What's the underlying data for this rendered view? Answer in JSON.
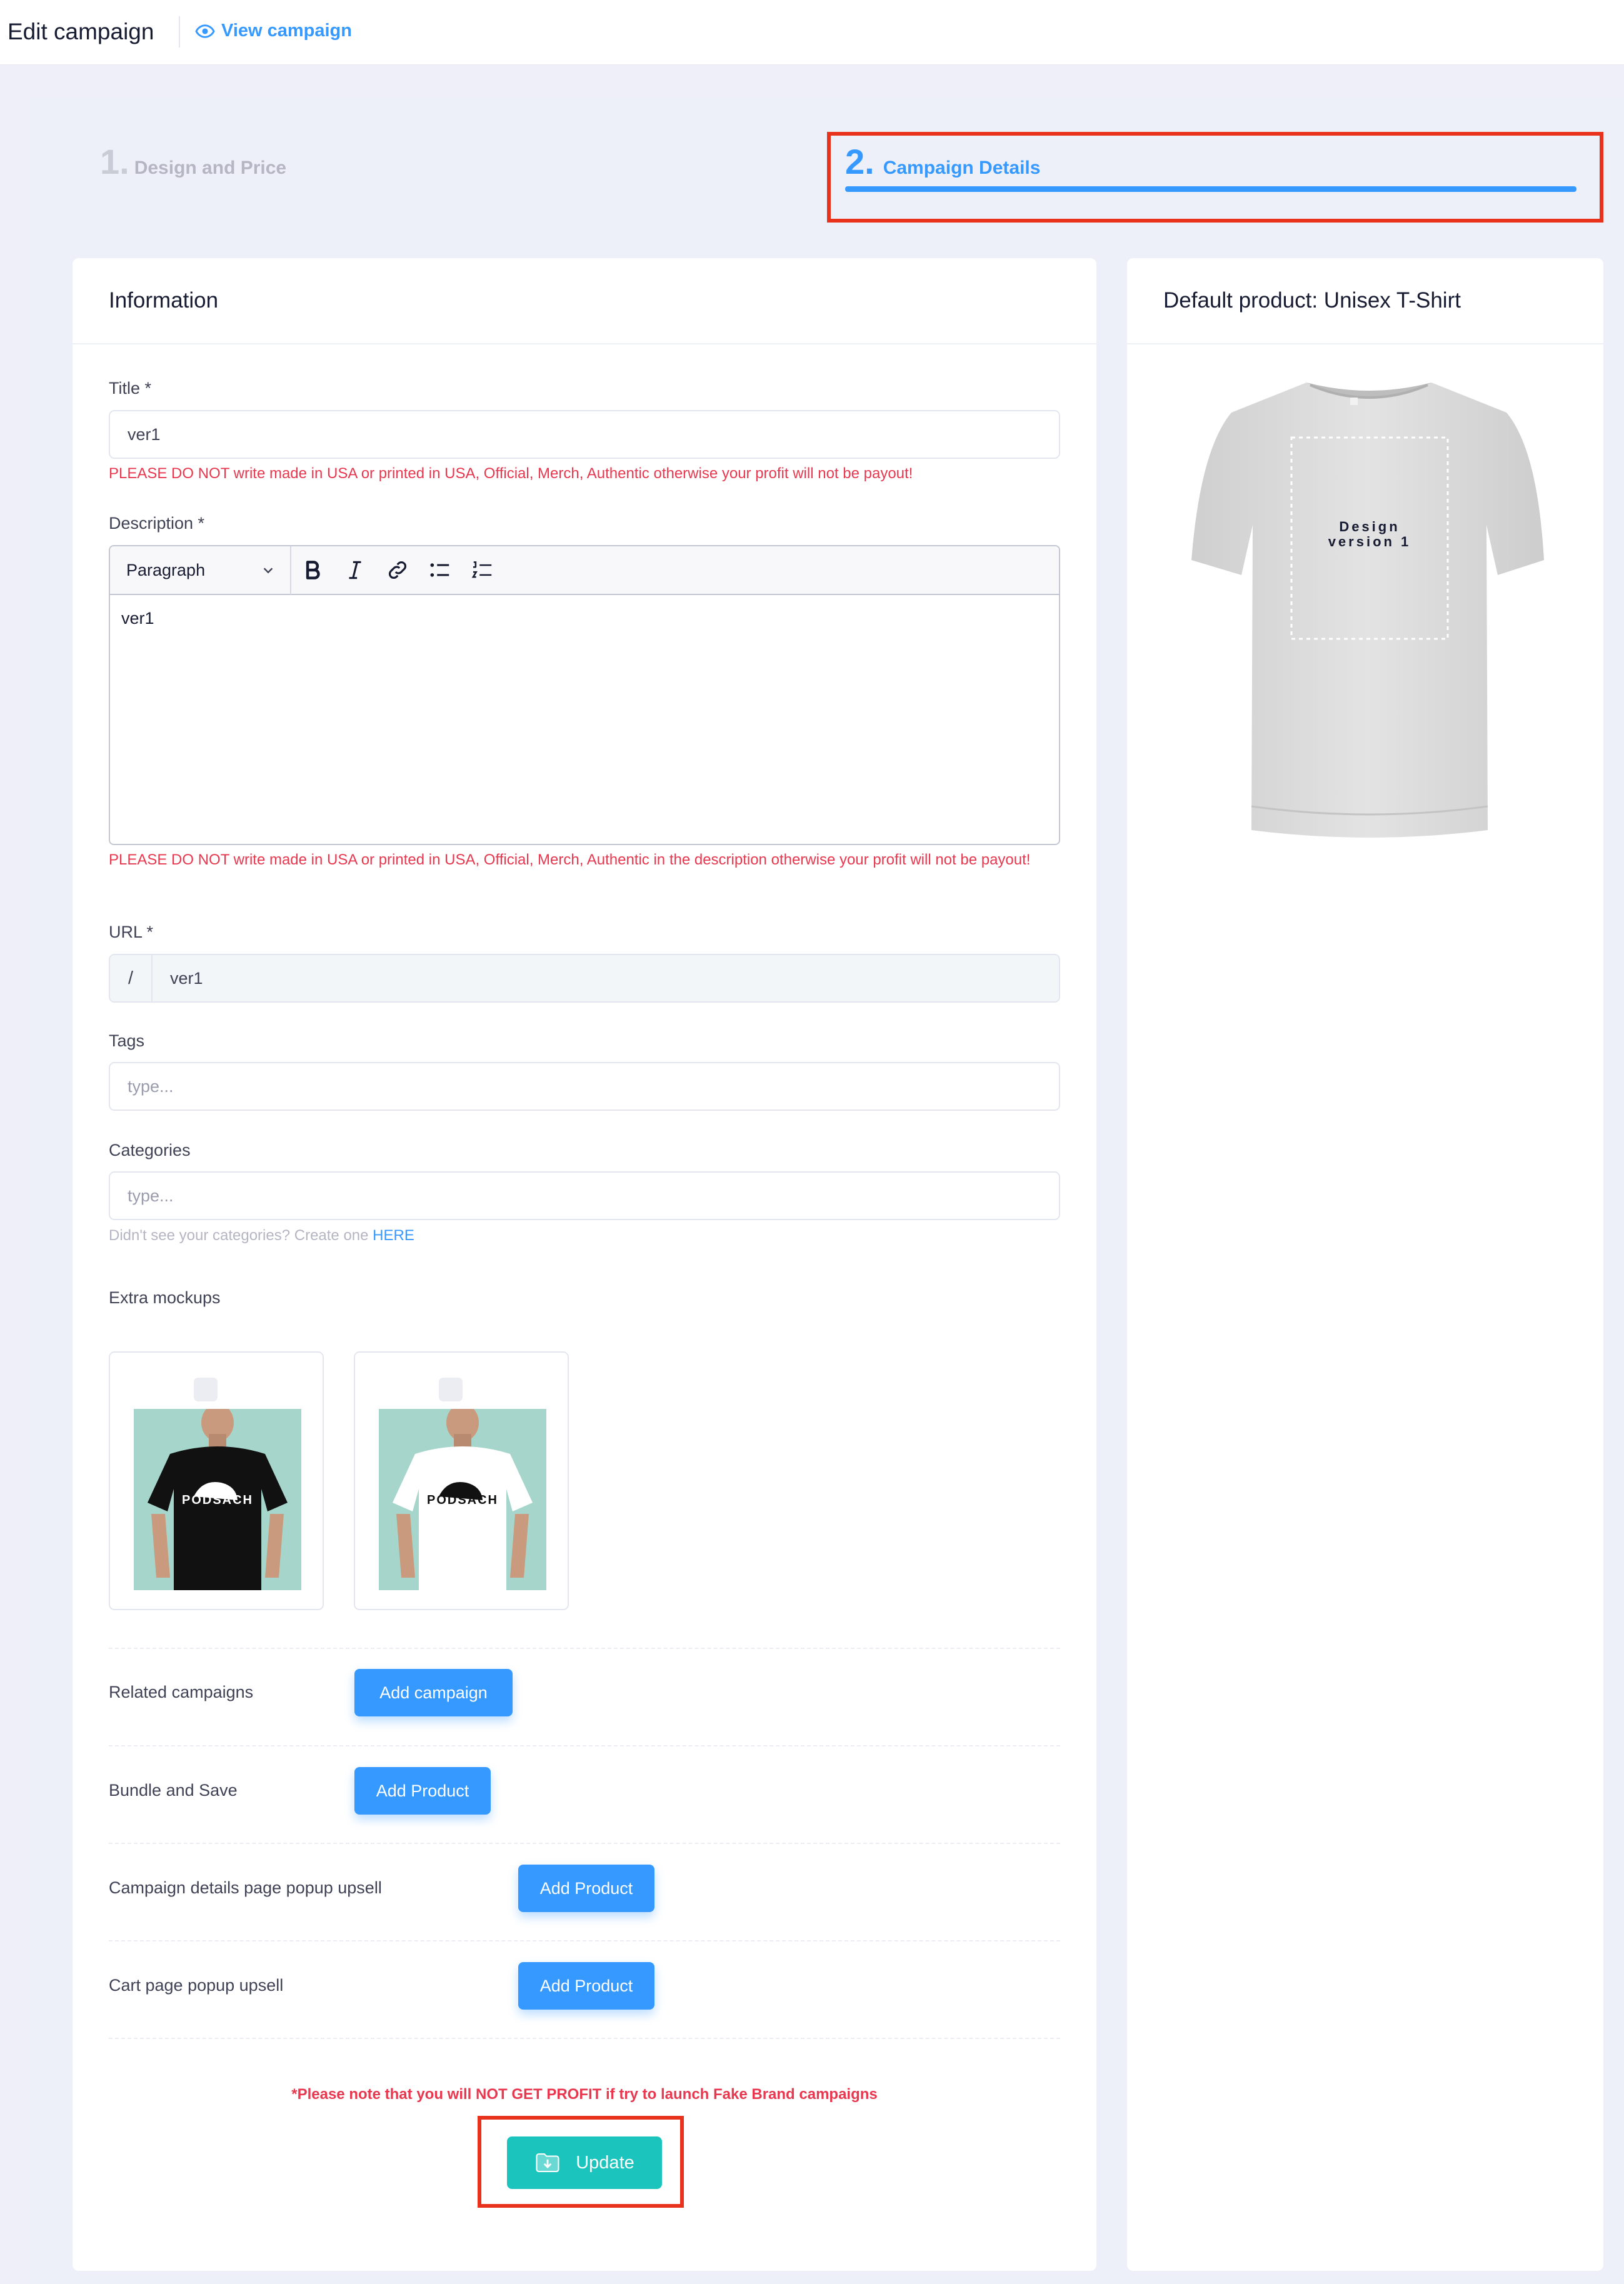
{
  "header": {
    "title": "Edit campaign",
    "view_link": "View campaign"
  },
  "steps": [
    {
      "number": "1.",
      "label": "Design and Price"
    },
    {
      "number": "2.",
      "label": "Campaign Details"
    }
  ],
  "info": {
    "heading": "Information",
    "title_label": "Title *",
    "title_value": "ver1",
    "title_warning": "PLEASE DO NOT write made in USA or printed in USA, Official, Merch, Authentic otherwise your profit will not be payout!",
    "description_label": "Description *",
    "editor": {
      "block_format": "Paragraph",
      "content": "ver1"
    },
    "description_warning": "PLEASE DO NOT write made in USA or printed in USA, Official, Merch, Authentic in the description otherwise your profit will not be payout!",
    "url_label": "URL *",
    "url_prefix": "/",
    "url_value": "ver1",
    "tags_label": "Tags",
    "tags_placeholder": "type...",
    "categories_label": "Categories",
    "categories_placeholder": "type...",
    "categories_hint": "Didn't see your categories? Create one",
    "categories_hint_link": "HERE",
    "mockups_label": "Extra mockups",
    "mockups": [
      {
        "shirt_color": "#111111",
        "print_color": "#ffffff",
        "text": "PODSACH"
      },
      {
        "shirt_color": "#ffffff",
        "print_color": "#111111",
        "text": "PODSACH"
      }
    ],
    "rows": [
      {
        "label": "Related campaigns",
        "button": "Add campaign"
      },
      {
        "label": "Bundle and Save",
        "button": "Add Product"
      },
      {
        "label": "Campaign details page popup upsell",
        "button": "Add Product"
      },
      {
        "label": "Cart page popup upsell",
        "button": "Add Product"
      }
    ],
    "notice": "*Please note that you will NOT GET PROFIT if try to launch Fake Brand campaigns",
    "update_button": "Update"
  },
  "product": {
    "heading": "Default product: Unisex T-Shirt",
    "design_text": [
      "Design",
      "version 1"
    ]
  },
  "colors": {
    "primary": "#3699ff",
    "success": "#1bc5bd",
    "danger": "#e8384f",
    "highlight": "#e8321c"
  }
}
